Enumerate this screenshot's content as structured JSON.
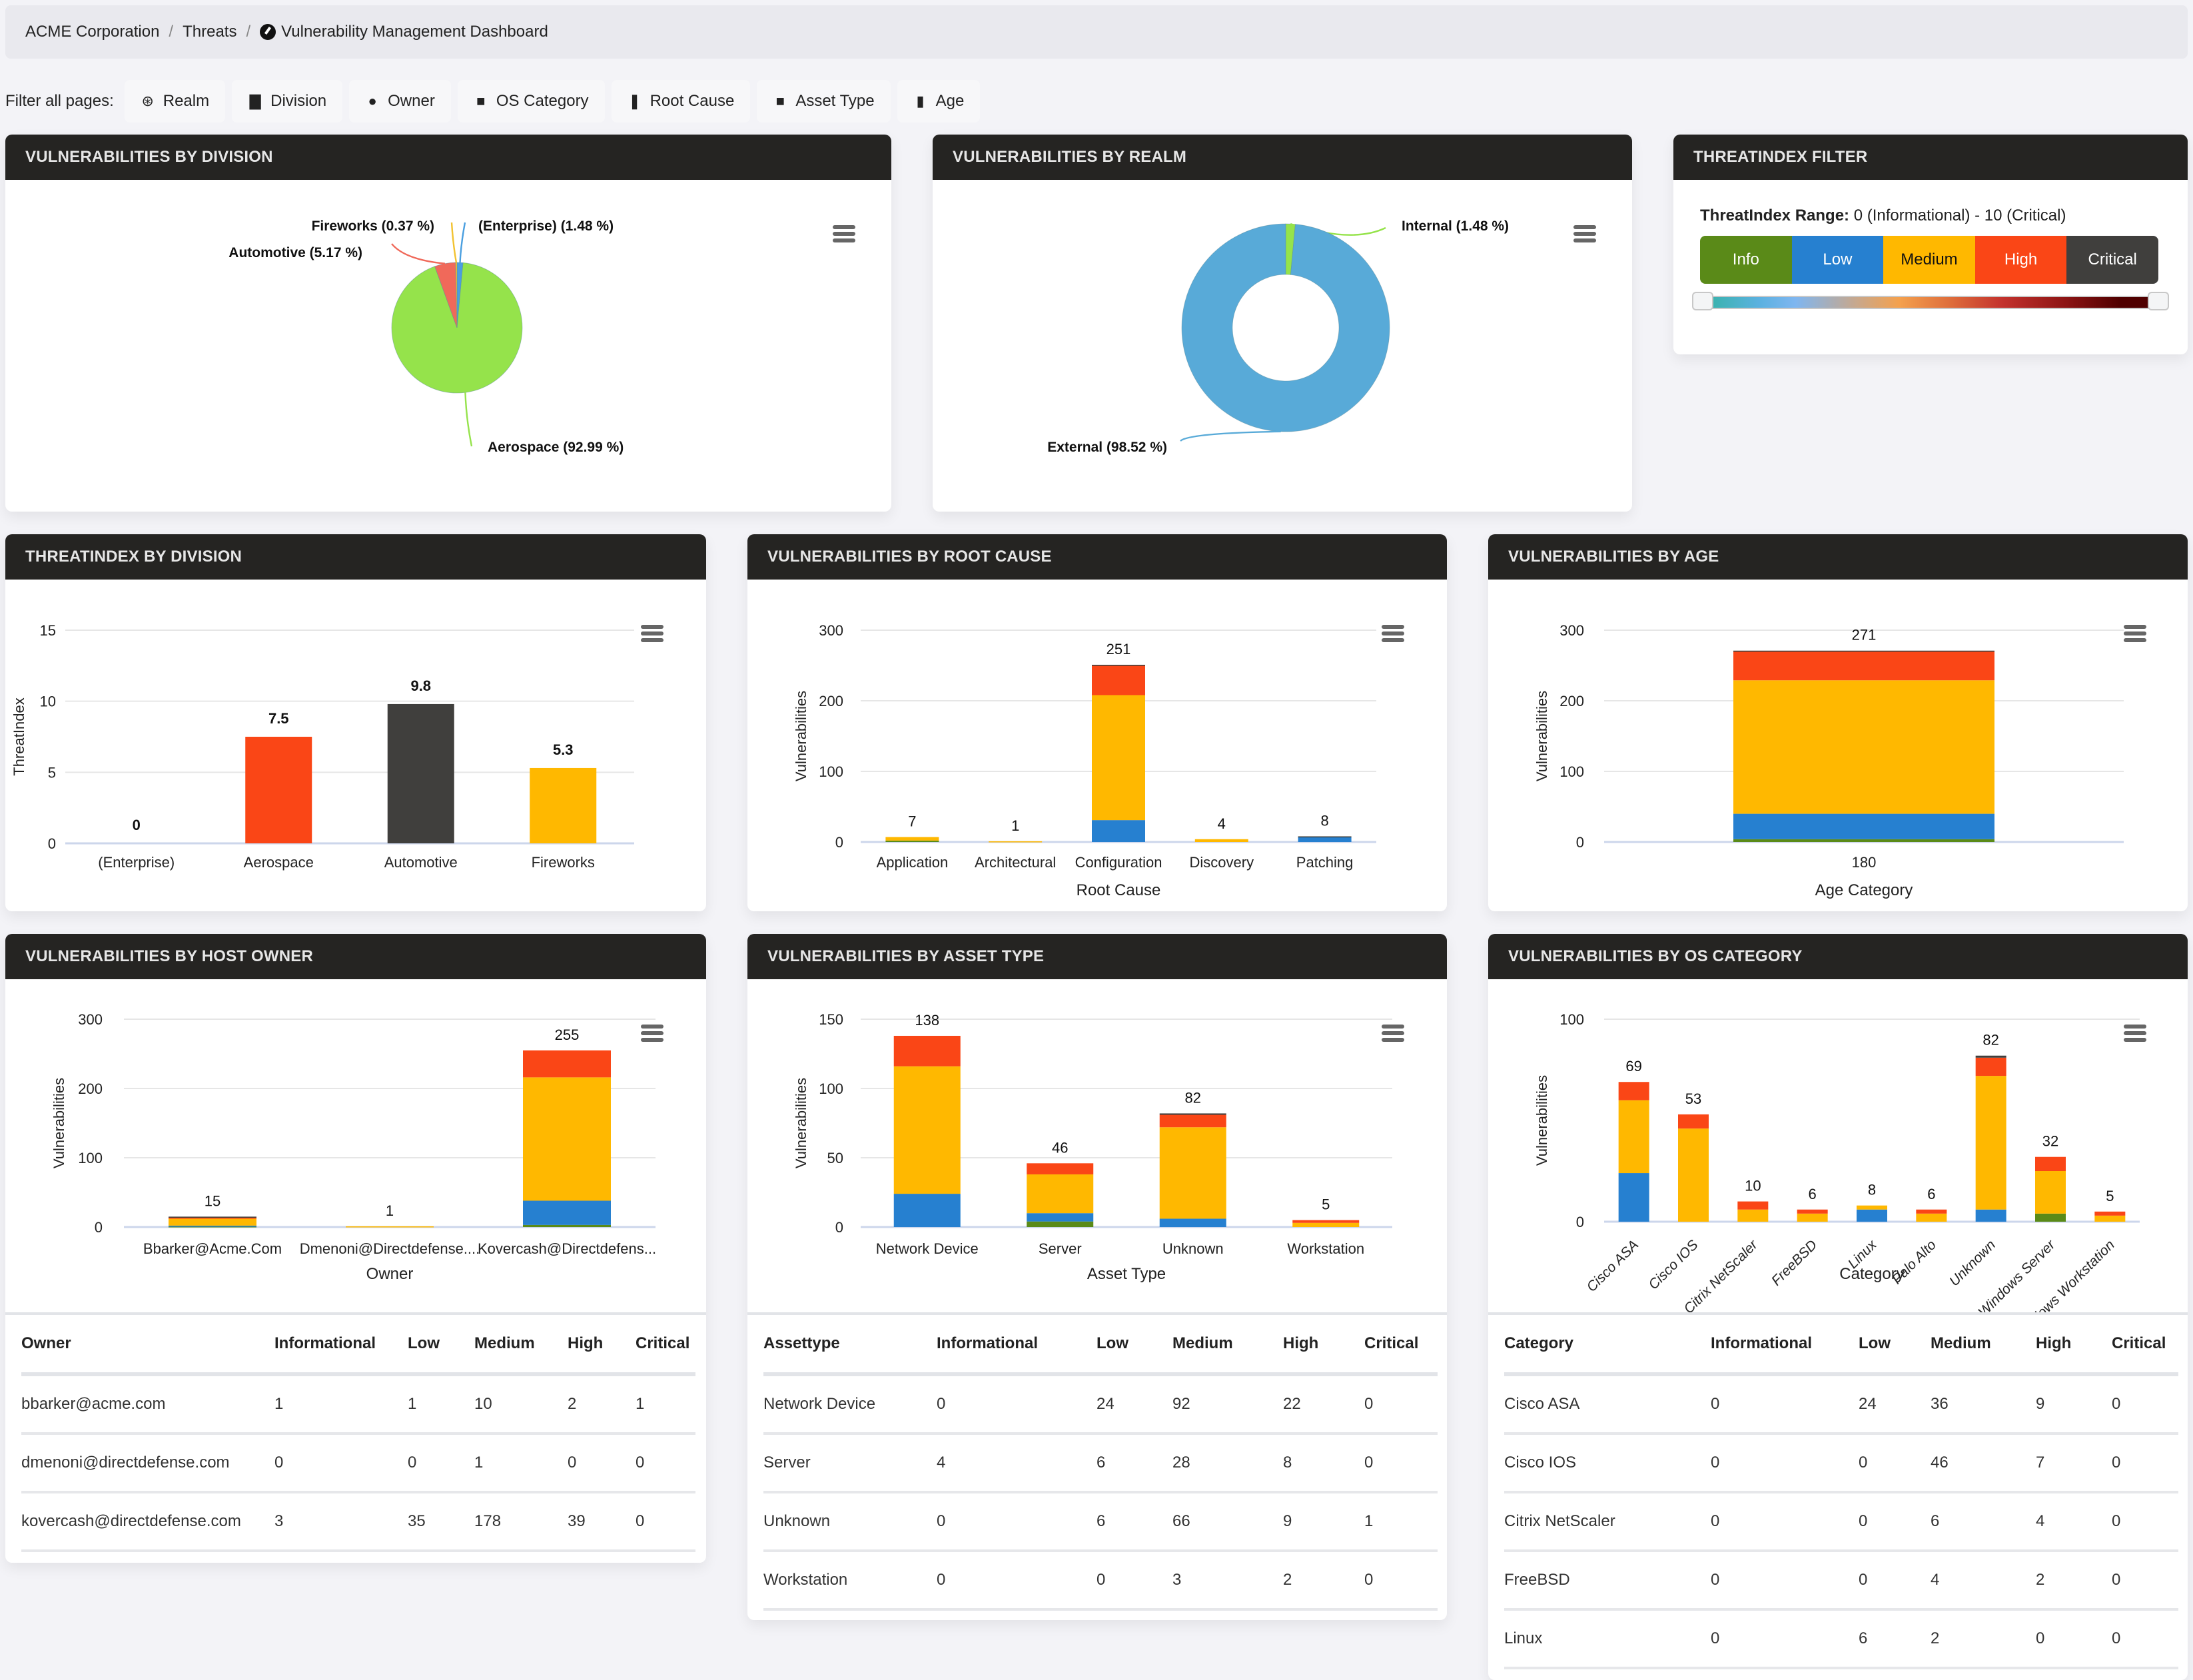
{
  "breadcrumb": {
    "items": [
      "ACME Corporation",
      "Threats"
    ],
    "current": "Vulnerability Management Dashboard",
    "current_icon": "gauge-icon"
  },
  "filters": {
    "label": "Filter all pages:",
    "chips": [
      {
        "label": "Realm",
        "icon": "realm-icon",
        "glyph": "⊛"
      },
      {
        "label": "Division",
        "icon": "building-icon",
        "glyph": "▇"
      },
      {
        "label": "Owner",
        "icon": "user-icon",
        "glyph": "●"
      },
      {
        "label": "OS Category",
        "icon": "briefcase-icon",
        "glyph": "■"
      },
      {
        "label": "Root Cause",
        "icon": "tooth-icon",
        "glyph": "❚"
      },
      {
        "label": "Asset Type",
        "icon": "briefcase-icon",
        "glyph": "■"
      },
      {
        "label": "Age",
        "icon": "calendar-icon",
        "glyph": "▮"
      }
    ]
  },
  "colors": {
    "info": "#5a8a18",
    "low": "#2680d0",
    "medium": "#ffb800",
    "high": "#fa4616",
    "critical": "#403f3d",
    "header_bg": "#252422"
  },
  "cards": {
    "division_pie": {
      "title": "VULNERABILITIES BY DIVISION"
    },
    "realm_donut": {
      "title": "VULNERABILITIES BY REALM"
    },
    "ti_filter": {
      "title": "THREATINDEX FILTER"
    },
    "ti_division": {
      "title": "THREATINDEX BY DIVISION"
    },
    "root_cause": {
      "title": "VULNERABILITIES BY ROOT CAUSE"
    },
    "age": {
      "title": "VULNERABILITIES BY AGE"
    },
    "host_owner": {
      "title": "VULNERABILITIES BY HOST OWNER"
    },
    "asset_type": {
      "title": "VULNERABILITIES BY ASSET TYPE"
    },
    "os_category": {
      "title": "VULNERABILITIES BY OS CATEGORY"
    }
  },
  "threatindex_filter": {
    "range_label": "ThreatIndex Range:",
    "range_value": "0 (Informational) - 10 (Critical)",
    "buttons": [
      {
        "label": "Info",
        "color": "#5a8a18",
        "text": "#ffffff"
      },
      {
        "label": "Low",
        "color": "#2680d0",
        "text": "#ffffff"
      },
      {
        "label": "Medium",
        "color": "#ffb800",
        "text": "#111111"
      },
      {
        "label": "High",
        "color": "#fa4616",
        "text": "#ffffff"
      },
      {
        "label": "Critical",
        "color": "#403f3d",
        "text": "#ffffff"
      }
    ],
    "slider_min": 0,
    "slider_max": 10
  },
  "chart_data": [
    {
      "id": "division_pie",
      "type": "pie",
      "title": "Vulnerabilities by Division",
      "slices": [
        {
          "label": "(Enterprise)",
          "percent": 1.48,
          "display": "(Enterprise) (1.48 %)",
          "color": "#4a9fe0"
        },
        {
          "label": "Aerospace",
          "percent": 92.99,
          "display": "Aerospace (92.99 %)",
          "color": "#95e34b"
        },
        {
          "label": "Automotive",
          "percent": 5.17,
          "display": "Automotive (5.17 %)",
          "color": "#f0695a"
        },
        {
          "label": "Fireworks",
          "percent": 0.37,
          "display": "Fireworks (0.37 %)",
          "color": "#f2c230"
        }
      ]
    },
    {
      "id": "realm_donut",
      "type": "pie",
      "title": "Vulnerabilities by Realm",
      "slices": [
        {
          "label": "Internal",
          "percent": 1.48,
          "display": "Internal (1.48 %)",
          "color": "#95e34b"
        },
        {
          "label": "External",
          "percent": 98.52,
          "display": "External (98.52 %)",
          "color": "#58aad8"
        }
      ]
    },
    {
      "id": "ti_division",
      "type": "bar",
      "title": "ThreatIndex by Division",
      "ylabel": "ThreatIndex",
      "xlabel": "",
      "ylim": [
        0,
        15
      ],
      "yticks": [
        0,
        5,
        10,
        15
      ],
      "categories": [
        "(Enterprise)",
        "Aerospace",
        "Automotive",
        "Fireworks"
      ],
      "values": [
        0,
        7.5,
        9.8,
        5.3
      ],
      "value_labels": [
        "0",
        "7.5",
        "9.8",
        "5.3"
      ],
      "colors": [
        "#2680d0",
        "#fa4616",
        "#403f3d",
        "#ffb800"
      ]
    },
    {
      "id": "root_cause",
      "type": "bar",
      "stacked": true,
      "title": "Vulnerabilities by Root Cause",
      "ylabel": "Vulnerabilities",
      "xlabel": "Root Cause",
      "ylim": [
        0,
        300
      ],
      "yticks": [
        0,
        100,
        200,
        300
      ],
      "categories": [
        "Application",
        "Architectural",
        "Configuration",
        "Discovery",
        "Patching"
      ],
      "totals": [
        7,
        1,
        251,
        4,
        8
      ],
      "series": [
        {
          "name": "Informational",
          "values": [
            2,
            0,
            0,
            0,
            0
          ]
        },
        {
          "name": "Low",
          "values": [
            0,
            0,
            31,
            0,
            7
          ]
        },
        {
          "name": "Medium",
          "values": [
            5,
            1,
            177,
            4,
            0
          ]
        },
        {
          "name": "High",
          "values": [
            0,
            0,
            42,
            0,
            0
          ]
        },
        {
          "name": "Critical",
          "values": [
            0,
            0,
            1,
            0,
            1
          ]
        }
      ]
    },
    {
      "id": "age",
      "type": "bar",
      "stacked": true,
      "title": "Vulnerabilities by Age",
      "ylabel": "Vulnerabilities",
      "xlabel": "Age Category",
      "ylim": [
        0,
        300
      ],
      "yticks": [
        0,
        100,
        200,
        300
      ],
      "categories": [
        "180"
      ],
      "totals": [
        271
      ],
      "series": [
        {
          "name": "Informational",
          "values": [
            4
          ]
        },
        {
          "name": "Low",
          "values": [
            36
          ]
        },
        {
          "name": "Medium",
          "values": [
            189
          ]
        },
        {
          "name": "High",
          "values": [
            41
          ]
        },
        {
          "name": "Critical",
          "values": [
            1
          ]
        }
      ]
    },
    {
      "id": "host_owner",
      "type": "bar",
      "stacked": true,
      "title": "Vulnerabilities by Host Owner",
      "ylabel": "Vulnerabilities",
      "xlabel": "Owner",
      "ylim": [
        0,
        300
      ],
      "yticks": [
        0,
        100,
        200,
        300
      ],
      "categories": [
        "Bbarker@Acme.Com",
        "Dmenoni@Directdefense....",
        "Kovercash@Directdefens..."
      ],
      "totals": [
        15,
        1,
        255
      ],
      "series": [
        {
          "name": "Informational",
          "values": [
            1,
            0,
            3
          ]
        },
        {
          "name": "Low",
          "values": [
            1,
            0,
            35
          ]
        },
        {
          "name": "Medium",
          "values": [
            10,
            1,
            178
          ]
        },
        {
          "name": "High",
          "values": [
            2,
            0,
            39
          ]
        },
        {
          "name": "Critical",
          "values": [
            1,
            0,
            0
          ]
        }
      ]
    },
    {
      "id": "asset_type",
      "type": "bar",
      "stacked": true,
      "title": "Vulnerabilities by Asset Type",
      "ylabel": "Vulnerabilities",
      "xlabel": "Asset Type",
      "ylim": [
        0,
        150
      ],
      "yticks": [
        0,
        50,
        100,
        150
      ],
      "categories": [
        "Network Device",
        "Server",
        "Unknown",
        "Workstation"
      ],
      "totals": [
        138,
        46,
        82,
        5
      ],
      "series": [
        {
          "name": "Informational",
          "values": [
            0,
            4,
            0,
            0
          ]
        },
        {
          "name": "Low",
          "values": [
            24,
            6,
            6,
            0
          ]
        },
        {
          "name": "Medium",
          "values": [
            92,
            28,
            66,
            3
          ]
        },
        {
          "name": "High",
          "values": [
            22,
            8,
            9,
            2
          ]
        },
        {
          "name": "Critical",
          "values": [
            0,
            0,
            1,
            0
          ]
        }
      ]
    },
    {
      "id": "os_category",
      "type": "bar",
      "stacked": true,
      "title": "Vulnerabilities by OS Category",
      "ylabel": "Vulnerabilities",
      "xlabel": "Category",
      "ylim": [
        0,
        100
      ],
      "yticks": [
        0,
        100
      ],
      "categories": [
        "Cisco ASA",
        "Cisco IOS",
        "Citrix NetScaler",
        "FreeBSD",
        "Linux",
        "Palo Alto",
        "Unknown",
        "Windows Server",
        "Windows Workstation"
      ],
      "totals": [
        69,
        53,
        10,
        6,
        8,
        6,
        82,
        32,
        5
      ],
      "series": [
        {
          "name": "Informational",
          "values": [
            0,
            0,
            0,
            0,
            0,
            0,
            0,
            4,
            0
          ]
        },
        {
          "name": "Low",
          "values": [
            24,
            0,
            0,
            0,
            6,
            0,
            6,
            0,
            0
          ]
        },
        {
          "name": "Medium",
          "values": [
            36,
            46,
            6,
            4,
            2,
            4,
            66,
            21,
            3
          ]
        },
        {
          "name": "High",
          "values": [
            9,
            7,
            4,
            2,
            0,
            2,
            9,
            7,
            2
          ]
        },
        {
          "name": "Critical",
          "values": [
            0,
            0,
            0,
            0,
            0,
            0,
            1,
            0,
            0
          ]
        }
      ]
    }
  ],
  "tables": {
    "owner": {
      "columns": [
        "Owner",
        "Informational",
        "Low",
        "Medium",
        "High",
        "Critical"
      ],
      "rows": [
        [
          "bbarker@acme.com",
          "1",
          "1",
          "10",
          "2",
          "1"
        ],
        [
          "dmenoni@directdefense.com",
          "0",
          "0",
          "1",
          "0",
          "0"
        ],
        [
          "kovercash@directdefense.com",
          "3",
          "35",
          "178",
          "39",
          "0"
        ]
      ]
    },
    "asset": {
      "columns": [
        "Assettype",
        "Informational",
        "Low",
        "Medium",
        "High",
        "Critical"
      ],
      "rows": [
        [
          "Network Device",
          "0",
          "24",
          "92",
          "22",
          "0"
        ],
        [
          "Server",
          "4",
          "6",
          "28",
          "8",
          "0"
        ],
        [
          "Unknown",
          "0",
          "6",
          "66",
          "9",
          "1"
        ],
        [
          "Workstation",
          "0",
          "0",
          "3",
          "2",
          "0"
        ]
      ]
    },
    "os": {
      "columns": [
        "Category",
        "Informational",
        "Low",
        "Medium",
        "High",
        "Critical"
      ],
      "rows": [
        [
          "Cisco ASA",
          "0",
          "24",
          "36",
          "9",
          "0"
        ],
        [
          "Cisco IOS",
          "0",
          "0",
          "46",
          "7",
          "0"
        ],
        [
          "Citrix NetScaler",
          "0",
          "0",
          "6",
          "4",
          "0"
        ],
        [
          "FreeBSD",
          "0",
          "0",
          "4",
          "2",
          "0"
        ],
        [
          "Linux",
          "0",
          "6",
          "2",
          "0",
          "0"
        ]
      ]
    }
  }
}
